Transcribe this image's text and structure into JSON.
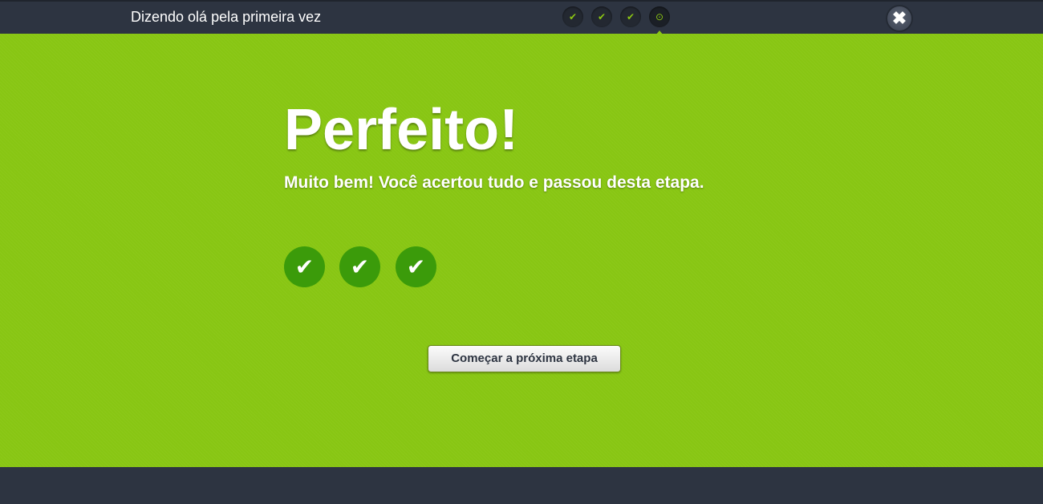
{
  "header": {
    "lesson_title": "Dizendo olá pela primeira vez",
    "progress_steps": [
      {
        "state": "done",
        "icon": "check-icon",
        "glyph": "✔"
      },
      {
        "state": "done",
        "icon": "check-icon",
        "glyph": "✔"
      },
      {
        "state": "done",
        "icon": "check-icon",
        "glyph": "✔"
      },
      {
        "state": "current",
        "icon": "target-icon",
        "glyph": "⊙"
      }
    ],
    "close_glyph": "✖"
  },
  "main": {
    "headline": "Perfeito!",
    "message": "Muito bem! Você acertou tudo e passou desta etapa.",
    "results": [
      {
        "correct": true,
        "glyph": "✔"
      },
      {
        "correct": true,
        "glyph": "✔"
      },
      {
        "correct": true,
        "glyph": "✔"
      }
    ],
    "next_button_label": "Começar a próxima etapa"
  },
  "colors": {
    "accent_green": "#88c613",
    "result_green": "#3b9b0a",
    "dark_bar": "#2d3441"
  }
}
